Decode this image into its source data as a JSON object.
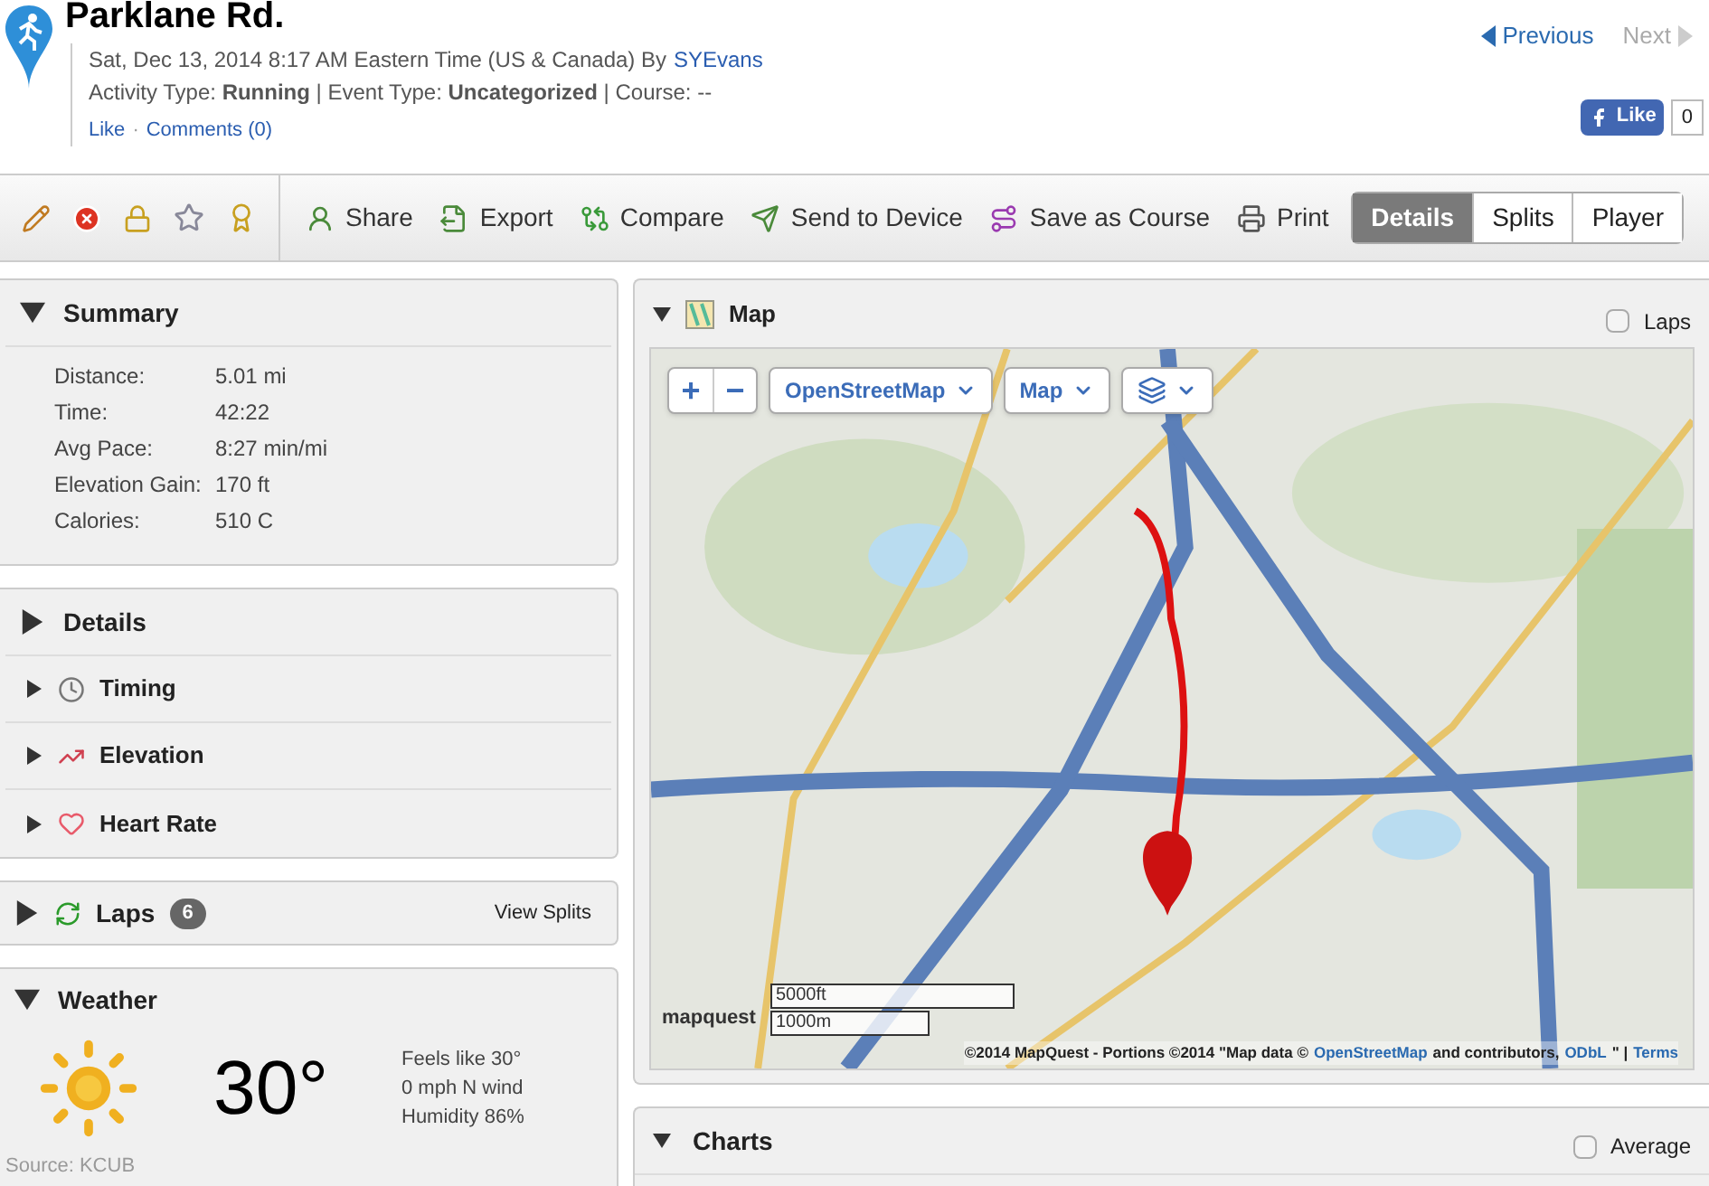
{
  "activity": {
    "title": "Parklane Rd.",
    "meta_prefix": "Sat, Dec 13, 2014 8:17 AM Eastern Time (US & Canada) By",
    "author": "SYEvans",
    "type_line": "Activity Type: **Running** | Event Type: **Uncategorized** | Course: --",
    "like": "Like",
    "separator": "·",
    "comments": "Comments (0)"
  },
  "pager": {
    "previous": "Previous",
    "next": "Next",
    "next_disabled": true
  },
  "facebook": {
    "label": "Like",
    "count": "0"
  },
  "toolbar": {
    "actions": [
      {
        "label": "Share"
      },
      {
        "label": "Export"
      },
      {
        "label": "Compare"
      },
      {
        "label": "Send to Device"
      },
      {
        "label": "Save as Course"
      },
      {
        "label": "Print"
      }
    ],
    "tabs": [
      {
        "label": "Details",
        "selected": true
      },
      {
        "label": "Splits",
        "selected": false
      },
      {
        "label": "Player",
        "selected": false
      }
    ]
  },
  "summary": {
    "title": "Summary",
    "expanded": true,
    "rows": [
      {
        "label": "Distance:",
        "value": "5.01 mi"
      },
      {
        "label": "Time:",
        "value": "42:22"
      },
      {
        "label": "Avg Pace:",
        "value": "8:27 min/mi"
      },
      {
        "label": "Elevation Gain:",
        "value": "170 ft"
      },
      {
        "label": "Calories:",
        "value": "510 C"
      }
    ]
  },
  "details": {
    "title": "Details",
    "expanded": false,
    "items": [
      {
        "label": "Timing",
        "expanded": false
      },
      {
        "label": "Elevation",
        "expanded": false
      },
      {
        "label": "Heart Rate",
        "expanded": false
      }
    ]
  },
  "laps": {
    "title": "Laps",
    "count": "6",
    "expanded": false,
    "link": "View Splits"
  },
  "weather": {
    "title": "Weather",
    "expanded": true,
    "temperature": "30°",
    "lines": [
      "Feels like 30°",
      "0 mph N wind",
      "Humidity 86%"
    ],
    "source": "Source: KCUB"
  },
  "map": {
    "title": "Map",
    "expanded": true,
    "laps_toggle": {
      "label": "Laps",
      "checked": false
    },
    "zoom_in": "+",
    "zoom_out": "−",
    "provider": "OpenStreetMap",
    "view": "Map",
    "scale": [
      "5000ft",
      "1000m"
    ],
    "logo": "mapquest",
    "attribution": {
      "text": "©2014 MapQuest  -  Portions ©2014 \"Map data ©",
      "osm": "OpenStreetMap",
      "mid": "and contributors,",
      "license": "ODbL",
      "end": "\" |",
      "terms": "Terms"
    }
  },
  "charts": {
    "title": "Charts",
    "expanded": true,
    "average_toggle": {
      "label": "Average",
      "checked": false
    }
  }
}
